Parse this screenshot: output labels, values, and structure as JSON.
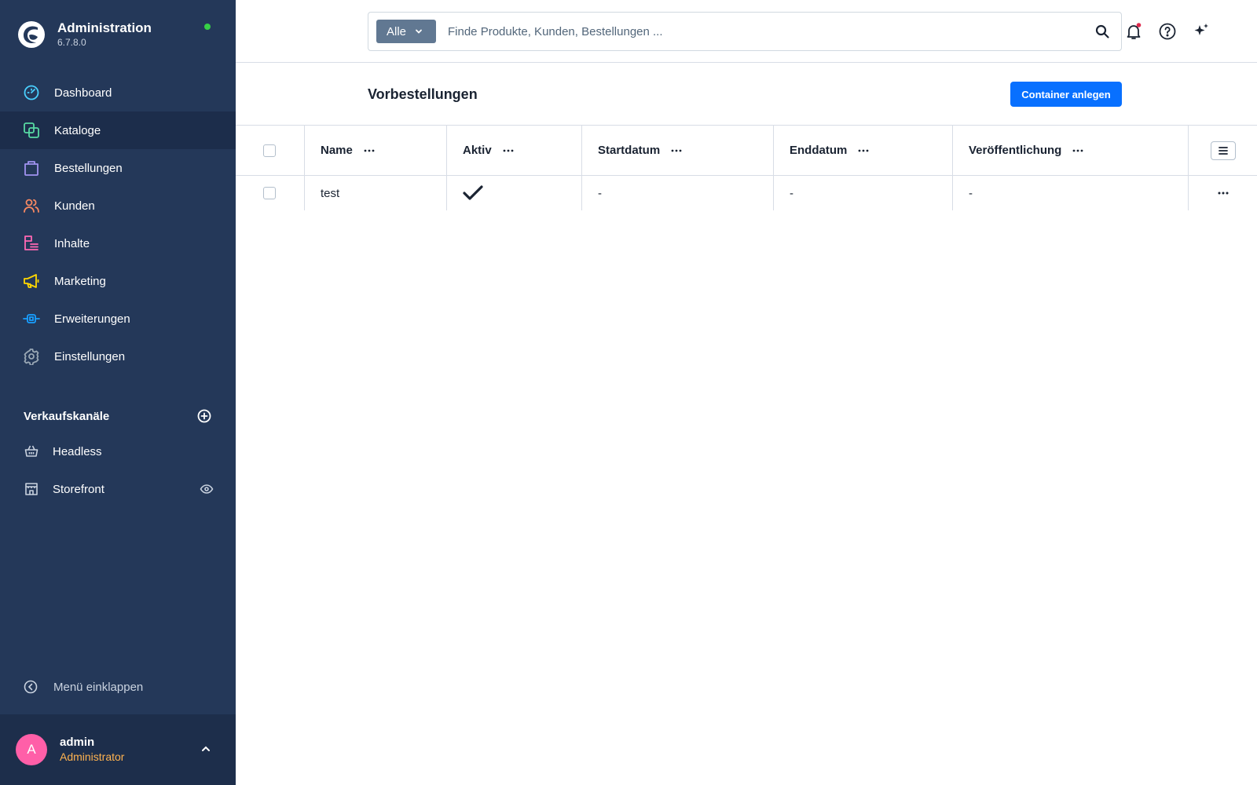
{
  "app": {
    "title": "Administration",
    "version": "6.7.8.0"
  },
  "sidebar": {
    "items": [
      {
        "label": "Dashboard",
        "icon": "gauge-icon",
        "color": "#4ad0ff"
      },
      {
        "label": "Kataloge",
        "icon": "products-icon",
        "color": "#57d9a3",
        "active": true
      },
      {
        "label": "Bestellungen",
        "icon": "shopping-bag-icon",
        "color": "#a092f0"
      },
      {
        "label": "Kunden",
        "icon": "users-icon",
        "color": "#f88962"
      },
      {
        "label": "Inhalte",
        "icon": "content-icon",
        "color": "#ff68b4"
      },
      {
        "label": "Marketing",
        "icon": "megaphone-icon",
        "color": "#ffd700"
      },
      {
        "label": "Erweiterungen",
        "icon": "plug-icon",
        "color": "#189eff"
      },
      {
        "label": "Einstellungen",
        "icon": "gear-icon",
        "color": "#9aa8b5"
      }
    ],
    "sales_channels_title": "Verkaufskanäle",
    "sales_channels": [
      {
        "label": "Headless",
        "icon": "basket-icon"
      },
      {
        "label": "Storefront",
        "icon": "storefront-icon"
      }
    ],
    "collapse_label": "Menü einklappen",
    "user": {
      "initial": "A",
      "name": "admin",
      "role": "Administrator"
    }
  },
  "search": {
    "type_label": "Alle",
    "placeholder": "Finde Produkte, Kunden, Bestellungen ..."
  },
  "page": {
    "title": "Vorbestellungen",
    "create_button": "Container anlegen"
  },
  "table": {
    "columns": [
      "Name",
      "Aktiv",
      "Startdatum",
      "Enddatum",
      "Veröffentlichung"
    ],
    "rows": [
      {
        "name": "test",
        "active": true,
        "start": "-",
        "end": "-",
        "publish": "-"
      }
    ]
  },
  "colors": {
    "sidebar_bg": "#243859",
    "accent": "#0870ff",
    "status_online": "#37d046",
    "notification": "#de294c"
  }
}
